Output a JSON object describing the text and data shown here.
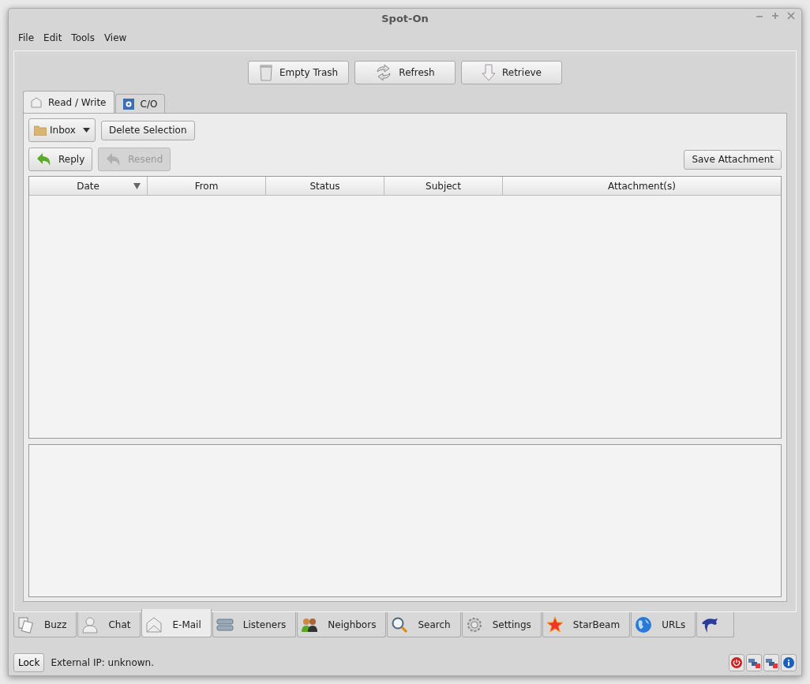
{
  "window": {
    "title": "Spot-On"
  },
  "menu": [
    "File",
    "Edit",
    "Tools",
    "View"
  ],
  "toolbar_buttons": [
    "Empty Trash",
    "Refresh",
    "Retrieve"
  ],
  "mail_tabs": [
    {
      "label": "Read / Write",
      "selected": true
    },
    {
      "label": "C/O",
      "selected": false
    }
  ],
  "folder": {
    "value": "Inbox"
  },
  "actions": [
    {
      "label": "Delete Selection",
      "disabled": false
    },
    {
      "label": "Reply",
      "disabled": false
    },
    {
      "label": "Resend",
      "disabled": true
    },
    {
      "label": "Save Attachment",
      "disabled": false
    }
  ],
  "table": {
    "columns": [
      {
        "label": "Date",
        "sorted": true
      },
      {
        "label": "From",
        "sorted": false
      },
      {
        "label": "Status",
        "sorted": false
      },
      {
        "label": "Subject",
        "sorted": false
      },
      {
        "label": "Attachment(s)",
        "sorted": false
      }
    ]
  },
  "main_tabs": [
    {
      "label": "Buzz",
      "selected": false
    },
    {
      "label": "Chat",
      "selected": false
    },
    {
      "label": "E-Mail",
      "selected": true
    },
    {
      "label": "Listeners",
      "selected": false
    },
    {
      "label": "Neighbors",
      "selected": false
    },
    {
      "label": "Search",
      "selected": false
    },
    {
      "label": "Settings",
      "selected": false
    },
    {
      "label": "StarBeam",
      "selected": false
    },
    {
      "label": "URLs",
      "selected": false
    },
    {
      "selected": false
    }
  ],
  "status_bar": {
    "lock_button": "Lock",
    "text": "External IP: unknown."
  }
}
